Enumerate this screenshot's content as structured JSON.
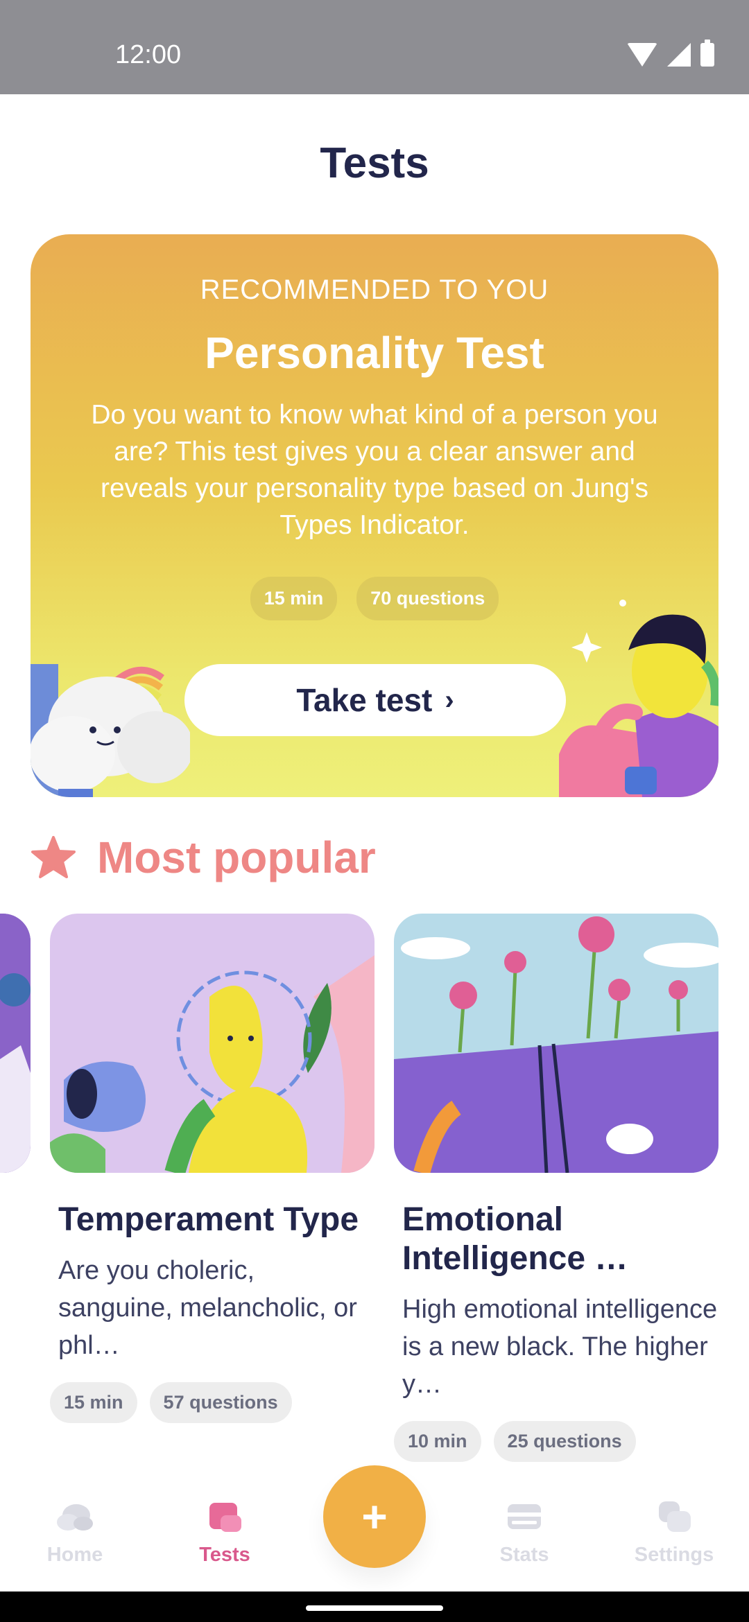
{
  "status_bar": {
    "time": "12:00"
  },
  "page": {
    "title": "Tests"
  },
  "hero": {
    "eyebrow": "RECOMMENDED TO YOU",
    "title": "Personality Test",
    "description": "Do you want to know what kind of a person you are? This test gives you a clear answer and reveals your personality type based on Jung's Types Indicator.",
    "chips": [
      "15 min",
      "70 questions"
    ],
    "button_label": "Take test",
    "button_icon": "chevron-right-icon"
  },
  "popular": {
    "title": "Most popular",
    "icon": "star-icon",
    "accent": "#ee8785",
    "cards": [
      {
        "title": "Temperament Type",
        "description": "Are you choleric, sanguine, melancholic, or phl…",
        "duration": "15 min",
        "questions": "57 questions"
      },
      {
        "title": "Emotional Intelligence …",
        "description": "High emotional intelligence is a new black. The higher y…",
        "duration": "10 min",
        "questions": "25 questions"
      }
    ]
  },
  "nav": {
    "items": [
      {
        "label": "Home",
        "icon": "cloud-icon",
        "active": false
      },
      {
        "label": "Tests",
        "icon": "tests-icon",
        "active": true
      },
      {
        "label": "Stats",
        "icon": "stats-icon",
        "active": false
      },
      {
        "label": "Settings",
        "icon": "settings-icon",
        "active": false
      }
    ],
    "fab_icon": "plus-icon",
    "fab_label": "+"
  },
  "colors": {
    "active": "#d9598c",
    "inactive": "#dadbe3",
    "fab": "#f1b046",
    "hero_top": "#e9ad52",
    "hero_bottom": "#eef07a"
  }
}
